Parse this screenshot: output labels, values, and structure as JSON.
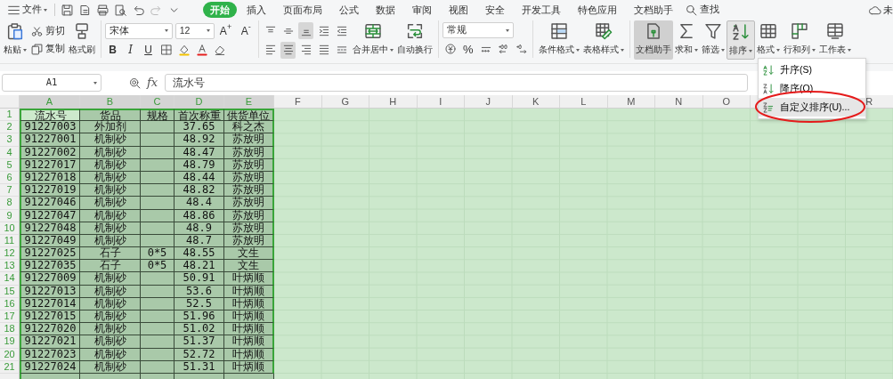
{
  "menu": {
    "file": "文件",
    "tabs": [
      {
        "label": "开始",
        "selected": true
      },
      {
        "label": "插入",
        "selected": false
      },
      {
        "label": "页面布局",
        "selected": false
      },
      {
        "label": "公式",
        "selected": false
      },
      {
        "label": "数据",
        "selected": false
      },
      {
        "label": "审阅",
        "selected": false
      },
      {
        "label": "视图",
        "selected": false
      },
      {
        "label": "安全",
        "selected": false
      },
      {
        "label": "开发工具",
        "selected": false
      },
      {
        "label": "特色应用",
        "selected": false
      },
      {
        "label": "文档助手",
        "selected": false
      }
    ],
    "search": "查找",
    "account": "未"
  },
  "ribbon": {
    "paste": "粘贴",
    "cut": "剪切",
    "copy": "复制",
    "format_painter": "格式刷",
    "font_name": "宋体",
    "font_size": "12",
    "grow_font": "A$^{+}$",
    "shrink_font": "A$^{-}$",
    "bold": "B",
    "italic": "I",
    "underline": "U",
    "merge": "合并居中",
    "wrap": "自动换行",
    "number_format": "常规",
    "percent": "%",
    "conditional": "条件格式",
    "table_style": "表格样式",
    "big": [
      {
        "label": "文档助手",
        "selected": true
      },
      {
        "label": "求和",
        "selected": false
      },
      {
        "label": "筛选",
        "selected": false
      },
      {
        "label": "排序",
        "selected": false,
        "expanded": true
      },
      {
        "label": "格式",
        "selected": false
      },
      {
        "label": "行和列",
        "selected": false
      },
      {
        "label": "工作表",
        "selected": false
      }
    ]
  },
  "sort_menu": [
    {
      "label": "升序(S)",
      "highlighted": false,
      "circled": false
    },
    {
      "label": "降序(O)",
      "highlighted": false,
      "circled": false
    },
    {
      "label": "自定义排序(U)...",
      "highlighted": true,
      "circled": true
    }
  ],
  "name_box": "A1",
  "fx": "fx",
  "formula": "流水号",
  "columns": [
    {
      "label": "A",
      "selected": true
    },
    {
      "label": "B",
      "selected": true
    },
    {
      "label": "C",
      "selected": true
    },
    {
      "label": "D",
      "selected": true
    },
    {
      "label": "E",
      "selected": true
    },
    {
      "label": "F",
      "selected": false
    },
    {
      "label": "G",
      "selected": false
    },
    {
      "label": "H",
      "selected": false
    },
    {
      "label": "I",
      "selected": false
    },
    {
      "label": "J",
      "selected": false
    },
    {
      "label": "K",
      "selected": false
    },
    {
      "label": "L",
      "selected": false
    },
    {
      "label": "M",
      "selected": false
    },
    {
      "label": "N",
      "selected": false
    },
    {
      "label": "O",
      "selected": false
    },
    {
      "selected": false
    },
    {},
    {
      "label": "R",
      "selected": false
    }
  ],
  "rows": [
    {
      "n": "1",
      "active": true,
      "A": "流水号",
      "B": "货品",
      "C": "规格",
      "D": "首次称重",
      "E": "供货单位"
    },
    {
      "n": "2",
      "active": false,
      "A": "91227003",
      "B": "外加剂",
      "D": "37.65",
      "E": "科之杰"
    },
    {
      "n": "3",
      "active": false,
      "A": "91227001",
      "B": "机制砂",
      "D": "48.92",
      "E": "苏放明"
    },
    {
      "n": "4",
      "active": false,
      "A": "91227002",
      "B": "机制砂",
      "D": "48.47",
      "E": "苏放明"
    },
    {
      "n": "5",
      "active": false,
      "A": "91227017",
      "B": "机制砂",
      "D": "48.79",
      "E": "苏放明"
    },
    {
      "n": "6",
      "active": false,
      "A": "91227018",
      "B": "机制砂",
      "D": "48.44",
      "E": "苏放明"
    },
    {
      "n": "7",
      "active": false,
      "A": "91227019",
      "B": "机制砂",
      "D": "48.82",
      "E": "苏放明"
    },
    {
      "n": "8",
      "active": false,
      "A": "91227046",
      "B": "机制砂",
      "D": "48.4",
      "E": "苏放明"
    },
    {
      "n": "9",
      "active": false,
      "A": "91227047",
      "B": "机制砂",
      "D": "48.86",
      "E": "苏放明"
    },
    {
      "n": "10",
      "active": false,
      "A": "91227048",
      "B": "机制砂",
      "D": "48.9",
      "E": "苏放明"
    },
    {
      "n": "11",
      "active": false,
      "A": "91227049",
      "B": "机制砂",
      "D": "48.7",
      "E": "苏放明"
    },
    {
      "n": "12",
      "active": false,
      "A": "91227025",
      "B": "石子",
      "C": "0*5",
      "D": "48.55",
      "E": "文生"
    },
    {
      "n": "13",
      "active": false,
      "A": "91227035",
      "B": "石子",
      "C": "0*5",
      "D": "48.21",
      "E": "文生"
    },
    {
      "n": "14",
      "active": false,
      "A": "91227009",
      "B": "机制砂",
      "D": "50.91",
      "E": "叶炳顺"
    },
    {
      "n": "15",
      "active": false,
      "A": "91227013",
      "B": "机制砂",
      "D": "53.6",
      "E": "叶炳顺"
    },
    {
      "n": "16",
      "active": false,
      "A": "91227014",
      "B": "机制砂",
      "D": "52.5",
      "E": "叶炳顺"
    },
    {
      "n": "17",
      "active": false,
      "A": "91227015",
      "B": "机制砂",
      "D": "51.96",
      "E": "叶炳顺"
    },
    {
      "n": "18",
      "active": false,
      "A": "91227020",
      "B": "机制砂",
      "D": "51.02",
      "E": "叶炳顺"
    },
    {
      "n": "19",
      "active": false,
      "A": "91227021",
      "B": "机制砂",
      "D": "51.37",
      "E": "叶炳顺"
    },
    {
      "n": "20",
      "active": false,
      "A": "91227023",
      "B": "机制砂",
      "D": "52.72",
      "E": "叶炳顺"
    },
    {
      "n": "21",
      "active": false,
      "A": "91227024",
      "B": "机制砂",
      "D": "51.31",
      "E": "叶炳顺"
    }
  ]
}
